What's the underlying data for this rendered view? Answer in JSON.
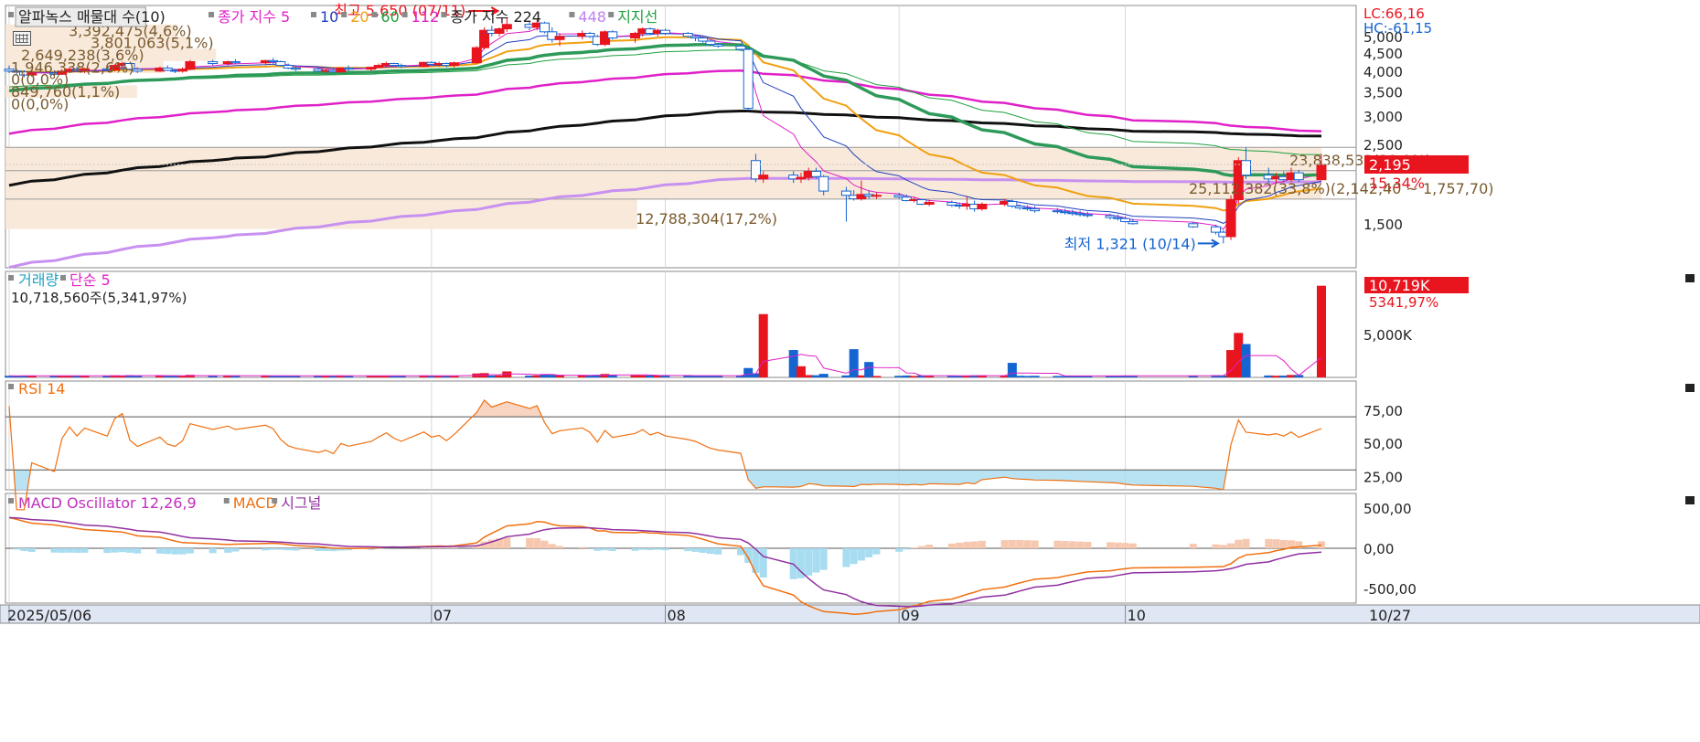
{
  "legend": {
    "main": [
      {
        "text": "알파녹스 매물대 수(10)",
        "color": "#222222",
        "box": true
      },
      {
        "text": "종가 지수 5",
        "color": "#e020c8"
      },
      {
        "text": "10",
        "color": "#2040c0"
      },
      {
        "text": "20",
        "color": "#f0a010"
      },
      {
        "text": "60",
        "color": "#20a040"
      },
      {
        "text": "112",
        "color": "#e020c8"
      },
      {
        "text": "종가 지수 224",
        "color": "#222222"
      },
      {
        "text": "448",
        "color": "#c080f0"
      },
      {
        "text": "지지선",
        "color": "#20a040"
      }
    ],
    "volume": [
      {
        "text": "거래량",
        "color": "#20a0c0"
      },
      {
        "text": "단순 5",
        "color": "#e020c8"
      }
    ],
    "volume_sub": "10,718,560주(5,341,97%)",
    "rsi": [
      {
        "text": "RSI 14",
        "color": "#f07010"
      }
    ],
    "macd": [
      {
        "text": "MACD Oscillator 12,26,9",
        "color": "#c030c0"
      },
      {
        "text": "MACD",
        "color": "#f07010"
      },
      {
        "text": "시그널",
        "color": "#9030a0"
      }
    ]
  },
  "corner": {
    "lc": "LC:66,16",
    "hc": "HC:-61,15"
  },
  "badges": {
    "price": "2,195",
    "price_pct": "15,34%",
    "volume": "10,719K",
    "volume_pct": "5341,97%"
  },
  "annotations": {
    "high": "최고 5,650 (07/11)",
    "low": "최저 1,321 (10/14)"
  },
  "x_labels": [
    "2025/05/06",
    "07",
    "08",
    "09",
    "10",
    "10/27"
  ],
  "colors": {
    "up": "#e8141e",
    "down": "#1464d2",
    "rsi": "#f07010",
    "macd": "#f07010",
    "signal": "#9030a0",
    "profile": "#f8e8d8"
  },
  "chart_data": [
    {
      "type": "candlestick",
      "panel": "price",
      "ylim": [
        1130,
        6100
      ],
      "y_scale": "log",
      "y_ticks": [
        {
          "value": 5000,
          "label": "5,000"
        },
        {
          "value": 4500,
          "label": "4,500"
        },
        {
          "value": 4000,
          "label": "4,000"
        },
        {
          "value": 3500,
          "label": "3,500"
        },
        {
          "value": 3000,
          "label": "3,000"
        },
        {
          "value": 2500,
          "label": "2,500"
        },
        {
          "value": 1500,
          "label": "1,500"
        }
      ],
      "x_range": [
        "2025-05-06",
        "2025-10-27"
      ],
      "x_ticks": [
        "2025-05-06",
        "2025-07-01",
        "2025-08-01",
        "2025-09-01",
        "2025-10-01"
      ],
      "ohlc": [
        [
          "2025-05-06",
          4050,
          4150,
          3950,
          4000
        ],
        [
          "2025-05-07",
          4000,
          4060,
          3920,
          3980
        ],
        [
          "2025-05-08",
          3980,
          4020,
          3850,
          3900
        ],
        [
          "2025-05-09",
          3900,
          4000,
          3860,
          3950
        ],
        [
          "2025-05-12",
          3950,
          4020,
          3880,
          3920
        ],
        [
          "2025-05-13",
          3920,
          4050,
          3900,
          4000
        ],
        [
          "2025-05-14",
          4000,
          4100,
          3950,
          4050
        ],
        [
          "2025-05-15",
          4050,
          4120,
          3980,
          4020
        ],
        [
          "2025-05-16",
          4020,
          4080,
          3950,
          4060
        ],
        [
          "2025-05-19",
          4060,
          4120,
          4000,
          4030
        ],
        [
          "2025-05-20",
          4030,
          4180,
          4000,
          4150
        ],
        [
          "2025-05-21",
          4150,
          4250,
          4100,
          4200
        ],
        [
          "2025-05-22",
          4200,
          4220,
          4020,
          4050
        ],
        [
          "2025-05-23",
          4050,
          4100,
          3950,
          4000
        ],
        [
          "2025-05-26",
          4000,
          4120,
          3980,
          4080
        ],
        [
          "2025-05-27",
          4080,
          4150,
          4000,
          4020
        ],
        [
          "2025-05-28",
          4020,
          4060,
          3950,
          4000
        ],
        [
          "2025-05-29",
          4000,
          4100,
          3960,
          4050
        ],
        [
          "2025-05-30",
          4050,
          4300,
          4020,
          4250
        ],
        [
          "2025-06-02",
          4250,
          4300,
          4150,
          4200
        ],
        [
          "2025-06-04",
          4200,
          4280,
          4150,
          4250
        ],
        [
          "2025-06-05",
          4250,
          4320,
          4180,
          4220
        ],
        [
          "2025-06-09",
          4220,
          4300,
          4150,
          4280
        ],
        [
          "2025-06-10",
          4280,
          4350,
          4200,
          4250
        ],
        [
          "2025-06-11",
          4250,
          4280,
          4120,
          4150
        ],
        [
          "2025-06-12",
          4150,
          4200,
          4050,
          4080
        ],
        [
          "2025-06-13",
          4080,
          4150,
          4000,
          4050
        ],
        [
          "2025-06-16",
          4050,
          4100,
          3980,
          4000
        ],
        [
          "2025-06-17",
          4000,
          4060,
          3950,
          4020
        ],
        [
          "2025-06-18",
          4020,
          4080,
          3960,
          3980
        ],
        [
          "2025-06-19",
          3980,
          4100,
          3960,
          4080
        ],
        [
          "2025-06-20",
          4080,
          4150,
          4000,
          4050
        ],
        [
          "2025-06-23",
          4050,
          4120,
          4000,
          4100
        ],
        [
          "2025-06-24",
          4100,
          4200,
          4080,
          4150
        ],
        [
          "2025-06-25",
          4150,
          4250,
          4100,
          4200
        ],
        [
          "2025-06-26",
          4200,
          4220,
          4100,
          4150
        ],
        [
          "2025-06-27",
          4150,
          4200,
          4080,
          4120
        ],
        [
          "2025-06-30",
          4120,
          4250,
          4100,
          4230
        ],
        [
          "2025-07-01",
          4230,
          4260,
          4150,
          4180
        ],
        [
          "2025-07-02",
          4180,
          4250,
          4120,
          4200
        ],
        [
          "2025-07-03",
          4200,
          4230,
          4100,
          4150
        ],
        [
          "2025-07-04",
          4150,
          4250,
          4100,
          4220
        ],
        [
          "2025-07-07",
          4220,
          4700,
          4200,
          4650
        ],
        [
          "2025-07-08",
          4650,
          5300,
          4600,
          5200
        ],
        [
          "2025-07-09",
          5200,
          5350,
          5000,
          5100
        ],
        [
          "2025-07-10",
          5100,
          5300,
          5000,
          5250
        ],
        [
          "2025-07-11",
          5250,
          5650,
          5150,
          5400
        ],
        [
          "2025-07-14",
          5400,
          5500,
          5200,
          5300
        ],
        [
          "2025-07-15",
          5300,
          5600,
          5200,
          5450
        ],
        [
          "2025-07-16",
          5450,
          5500,
          5100,
          5150
        ],
        [
          "2025-07-17",
          5150,
          5300,
          4800,
          4900
        ],
        [
          "2025-07-18",
          4900,
          5100,
          4700,
          5000
        ],
        [
          "2025-07-21",
          5000,
          5200,
          4900,
          5100
        ],
        [
          "2025-07-22",
          5100,
          5150,
          4950,
          5000
        ],
        [
          "2025-07-23",
          5000,
          5050,
          4700,
          4750
        ],
        [
          "2025-07-24",
          4750,
          5200,
          4700,
          5150
        ],
        [
          "2025-07-25",
          5150,
          5200,
          4900,
          4950
        ],
        [
          "2025-07-28",
          4950,
          5150,
          4800,
          5100
        ],
        [
          "2025-07-29",
          5100,
          5300,
          5000,
          5250
        ],
        [
          "2025-07-30",
          5250,
          5300,
          5050,
          5100
        ],
        [
          "2025-07-31",
          5100,
          5250,
          5000,
          5200
        ],
        [
          "2025-08-01",
          5200,
          5250,
          5050,
          5100
        ],
        [
          "2025-08-04",
          5100,
          5150,
          4950,
          5000
        ],
        [
          "2025-08-05",
          5000,
          5050,
          4850,
          4950
        ],
        [
          "2025-08-06",
          4950,
          5000,
          4800,
          4850
        ],
        [
          "2025-08-07",
          4850,
          4900,
          4700,
          4750
        ],
        [
          "2025-08-08",
          4750,
          4800,
          4650,
          4700
        ],
        [
          "2025-08-11",
          4700,
          4750,
          4550,
          4600
        ],
        [
          "2025-08-12",
          4600,
          4650,
          3100,
          3150
        ],
        [
          "2025-08-13",
          2250,
          2350,
          1960,
          2000
        ],
        [
          "2025-08-14",
          2000,
          2100,
          1950,
          2050
        ],
        [
          "2025-08-18",
          2050,
          2100,
          1950,
          2000
        ],
        [
          "2025-08-19",
          2000,
          2080,
          1950,
          2020
        ],
        [
          "2025-08-20",
          2020,
          2150,
          1980,
          2100
        ],
        [
          "2025-08-21",
          2100,
          2150,
          2000,
          2030
        ],
        [
          "2025-08-22",
          2030,
          2050,
          1800,
          1850
        ],
        [
          "2025-08-25",
          1850,
          1900,
          1520,
          1800
        ],
        [
          "2025-08-26",
          1800,
          1860,
          1740,
          1760
        ],
        [
          "2025-08-27",
          1760,
          1980,
          1740,
          1810
        ],
        [
          "2025-08-28",
          1810,
          1860,
          1760,
          1790
        ],
        [
          "2025-08-29",
          1790,
          1830,
          1760,
          1800
        ],
        [
          "2025-09-01",
          1800,
          1830,
          1760,
          1780
        ],
        [
          "2025-09-02",
          1780,
          1810,
          1730,
          1740
        ],
        [
          "2025-09-03",
          1740,
          1780,
          1720,
          1750
        ],
        [
          "2025-09-04",
          1750,
          1760,
          1690,
          1700
        ],
        [
          "2025-09-05",
          1700,
          1750,
          1680,
          1720
        ],
        [
          "2025-09-08",
          1720,
          1740,
          1670,
          1690
        ],
        [
          "2025-09-09",
          1690,
          1720,
          1650,
          1680
        ],
        [
          "2025-09-10",
          1680,
          1790,
          1640,
          1700
        ],
        [
          "2025-09-11",
          1700,
          1740,
          1620,
          1650
        ],
        [
          "2025-09-12",
          1650,
          1720,
          1630,
          1700
        ],
        [
          "2025-09-15",
          1700,
          1760,
          1680,
          1730
        ],
        [
          "2025-09-16",
          1730,
          1750,
          1660,
          1680
        ],
        [
          "2025-09-17",
          1680,
          1700,
          1640,
          1660
        ],
        [
          "2025-09-18",
          1660,
          1690,
          1630,
          1650
        ],
        [
          "2025-09-19",
          1650,
          1680,
          1610,
          1630
        ],
        [
          "2025-09-22",
          1630,
          1660,
          1600,
          1620
        ],
        [
          "2025-09-23",
          1620,
          1650,
          1590,
          1610
        ],
        [
          "2025-09-24",
          1610,
          1640,
          1580,
          1600
        ],
        [
          "2025-09-25",
          1600,
          1630,
          1570,
          1590
        ],
        [
          "2025-09-26",
          1590,
          1620,
          1560,
          1580
        ],
        [
          "2025-09-29",
          1580,
          1600,
          1540,
          1560
        ],
        [
          "2025-09-30",
          1560,
          1590,
          1530,
          1550
        ],
        [
          "2025-10-01",
          1550,
          1570,
          1510,
          1520
        ],
        [
          "2025-10-02",
          1520,
          1550,
          1490,
          1500
        ],
        [
          "2025-10-10",
          1500,
          1520,
          1460,
          1470
        ],
        [
          "2025-10-13",
          1470,
          1490,
          1400,
          1420
        ],
        [
          "2025-10-14",
          1420,
          1440,
          1321,
          1380
        ],
        [
          "2025-10-15",
          1380,
          1800,
          1350,
          1750
        ],
        [
          "2025-10-16",
          1750,
          2300,
          1700,
          2250
        ],
        [
          "2025-10-17",
          2250,
          2450,
          2000,
          2050
        ],
        [
          "2025-10-20",
          2050,
          2150,
          1950,
          2000
        ],
        [
          "2025-10-21",
          2000,
          2080,
          1950,
          2030
        ],
        [
          "2025-10-22",
          2030,
          2100,
          1960,
          1990
        ],
        [
          "2025-10-23",
          1990,
          2150,
          1960,
          2080
        ],
        [
          "2025-10-24",
          2080,
          2120,
          1960,
          1990
        ],
        [
          "2025-10-27",
          1990,
          2350,
          1980,
          2195
        ]
      ],
      "volume_profile": [
        {
          "label": "3,392,475(4,6%)",
          "price_from": 5000,
          "price_to": 5400
        },
        {
          "label": "3,801,063(5,1%)",
          "price_from": 4620,
          "price_to": 5000
        },
        {
          "label": "2,649,238(3,6%)",
          "price_from": 4270,
          "price_to": 4620
        },
        {
          "label": "1,946,338(2,6%)",
          "price_from": 3950,
          "price_to": 4270
        },
        {
          "label": "0(0,0%)",
          "price_from": 3650,
          "price_to": 3950
        },
        {
          "label": "849,760(1,1%)",
          "price_from": 3370,
          "price_to": 3650
        },
        {
          "label": "0(0,0%)",
          "price_from": 3120,
          "price_to": 3370
        },
        {
          "label": "23,838,533(32,0%)",
          "price_from": 2110,
          "price_to": 2450
        },
        {
          "label": "25,112,382(33,8%)(2,142,40 ~ 1,757,70)",
          "price_from": 1757,
          "price_to": 2110
        },
        {
          "label": "12,788,304(17,2%)",
          "price_from": 1450,
          "price_to": 1757
        }
      ],
      "support_levels": [
        2450,
        2110,
        1757
      ]
    },
    {
      "type": "bar",
      "panel": "volume",
      "ylim": [
        0,
        10900000
      ],
      "y_ticks": [
        {
          "value": 5000000,
          "label": "5,000K"
        }
      ],
      "last_volume": 10718560
    },
    {
      "type": "line",
      "panel": "rsi",
      "series": "RSI 14",
      "ylim": [
        15,
        97
      ],
      "y_ticks": [
        {
          "value": 75,
          "label": "75,00"
        },
        {
          "value": 50,
          "label": "50,00"
        },
        {
          "value": 25,
          "label": "25,00"
        }
      ],
      "upper_band": 70,
      "lower_band": 30
    },
    {
      "type": "line",
      "panel": "macd",
      "series": "MACD Oscillator 12,26,9",
      "ylim": [
        -680,
        680
      ],
      "y_ticks": [
        {
          "value": 500,
          "label": "500,00"
        },
        {
          "value": 0,
          "label": "0,00"
        },
        {
          "value": -500,
          "label": "-500,00"
        }
      ]
    }
  ]
}
